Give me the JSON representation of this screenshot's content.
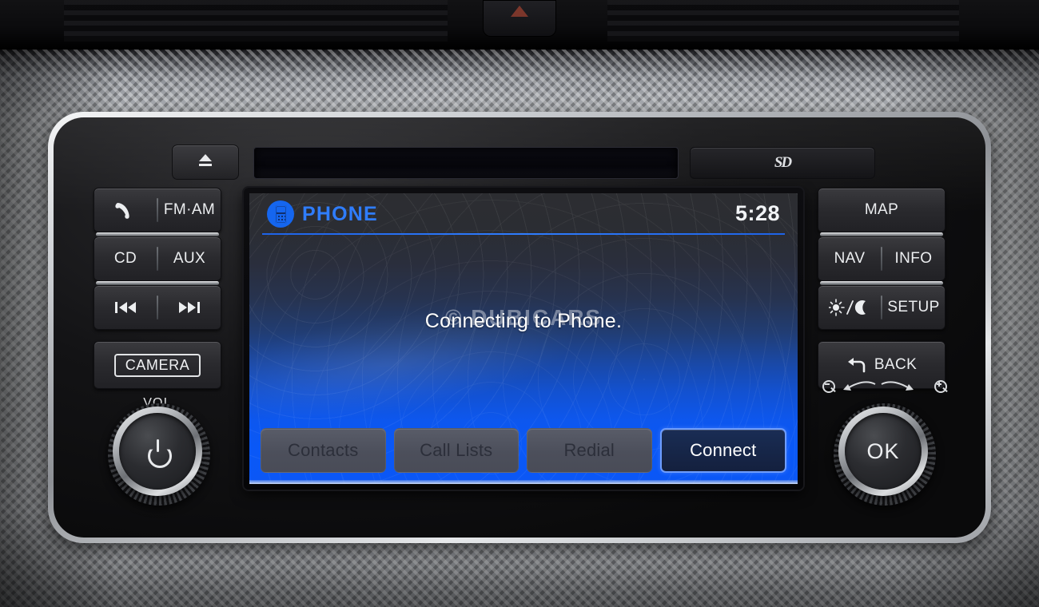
{
  "device": {
    "name": "car-infotainment-head-unit",
    "top_controls": {
      "eject_label": "eject",
      "cd_slot_label": "CD slot",
      "sd_slot_label": "SD"
    },
    "left_buttons": [
      {
        "id": "phone",
        "icon": "phone-handset-icon",
        "label": ""
      },
      {
        "id": "fm-am",
        "label": "FM·AM"
      },
      {
        "id": "cd",
        "label": "CD"
      },
      {
        "id": "aux",
        "label": "AUX"
      },
      {
        "id": "prev-track",
        "icon": "previous-track-icon",
        "label": "⏮"
      },
      {
        "id": "next-track",
        "icon": "next-track-icon",
        "label": "⏭"
      },
      {
        "id": "camera",
        "label": "CAMERA"
      }
    ],
    "volume_knob": {
      "label": "VOL",
      "icon": "power-icon"
    },
    "right_buttons": [
      {
        "id": "map",
        "label": "MAP"
      },
      {
        "id": "nav",
        "label": "NAV"
      },
      {
        "id": "info",
        "label": "INFO"
      },
      {
        "id": "day-night",
        "label": "☀/☽",
        "icon": "sun-moon-icon"
      },
      {
        "id": "setup",
        "label": "SETUP"
      },
      {
        "id": "back",
        "label": "BACK",
        "icon": "back-arrow-icon"
      }
    ],
    "ok_knob": {
      "label": "OK",
      "zoom_out_label": "zoom-out",
      "zoom_in_label": "zoom-in"
    }
  },
  "screen": {
    "header": {
      "icon": "phone-icon",
      "title": "PHONE",
      "time": "5:28"
    },
    "message": "Connecting to Phone.",
    "watermark": "© DUBICARS",
    "soft_buttons": [
      {
        "label": "Contacts",
        "state": "disabled"
      },
      {
        "label": "Call Lists",
        "state": "disabled"
      },
      {
        "label": "Redial",
        "state": "disabled"
      },
      {
        "label": "Connect",
        "state": "active"
      }
    ],
    "colors": {
      "accent_blue": "#2f7dff",
      "screen_blue": "#0a58f7",
      "header_dark": "#2c2d31",
      "active_border": "#6e9dff",
      "disabled_face": "#4c4f5b"
    }
  }
}
